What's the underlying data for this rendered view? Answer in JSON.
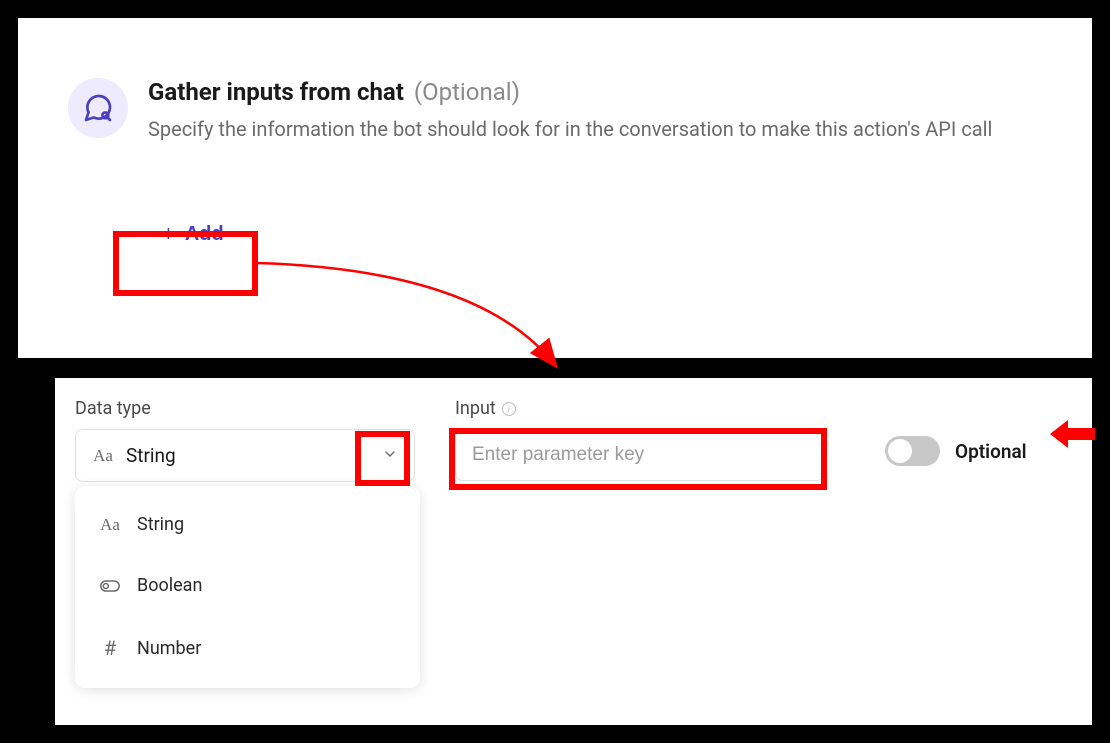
{
  "header": {
    "title": "Gather inputs from chat",
    "tag": "(Optional)",
    "description": "Specify the information the bot should look for in the conversation to make this action's API call"
  },
  "add_button": {
    "label": "Add"
  },
  "form": {
    "datatype_label": "Data type",
    "datatype_selected": "String",
    "input_label": "Input",
    "input_placeholder": "Enter parameter key",
    "toggle_label": "Optional"
  },
  "dropdown_options": [
    {
      "label": "String",
      "icon": "string"
    },
    {
      "label": "Boolean",
      "icon": "boolean"
    },
    {
      "label": "Number",
      "icon": "number"
    }
  ]
}
